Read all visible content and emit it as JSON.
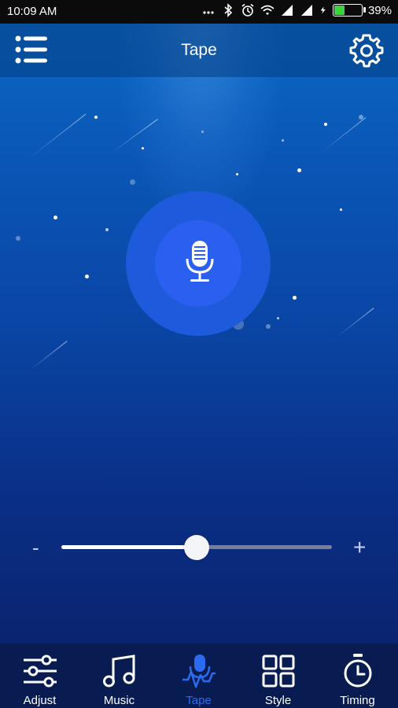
{
  "status_bar": {
    "time": "10:09 AM",
    "battery_percent": "39%",
    "battery_level": 0.39,
    "icons": [
      "dots-icon",
      "bluetooth-icon",
      "alarm-icon",
      "wifi-icon",
      "signal-icon",
      "signal-icon",
      "charging-icon",
      "battery-icon"
    ]
  },
  "header": {
    "title": "Tape",
    "left_icon": "menu-list-icon",
    "right_icon": "gear-icon"
  },
  "mic": {
    "icon": "microphone-icon"
  },
  "volume": {
    "minus_label": "-",
    "plus_label": "+",
    "level": 0.5
  },
  "bottom_nav": {
    "active": "Tape",
    "tabs": [
      {
        "label": "Adjust",
        "icon": "sliders-icon"
      },
      {
        "label": "Music",
        "icon": "music-note-icon"
      },
      {
        "label": "Tape",
        "icon": "tape-mic-icon"
      },
      {
        "label": "Style",
        "icon": "grid-icon"
      },
      {
        "label": "Timing",
        "icon": "stopwatch-icon"
      }
    ]
  },
  "colors": {
    "active_tab": "#2a6bf0",
    "mic_outer": "#1d5bdc",
    "mic_inner": "#2a5ff0",
    "nav_bg": "#081c52"
  }
}
